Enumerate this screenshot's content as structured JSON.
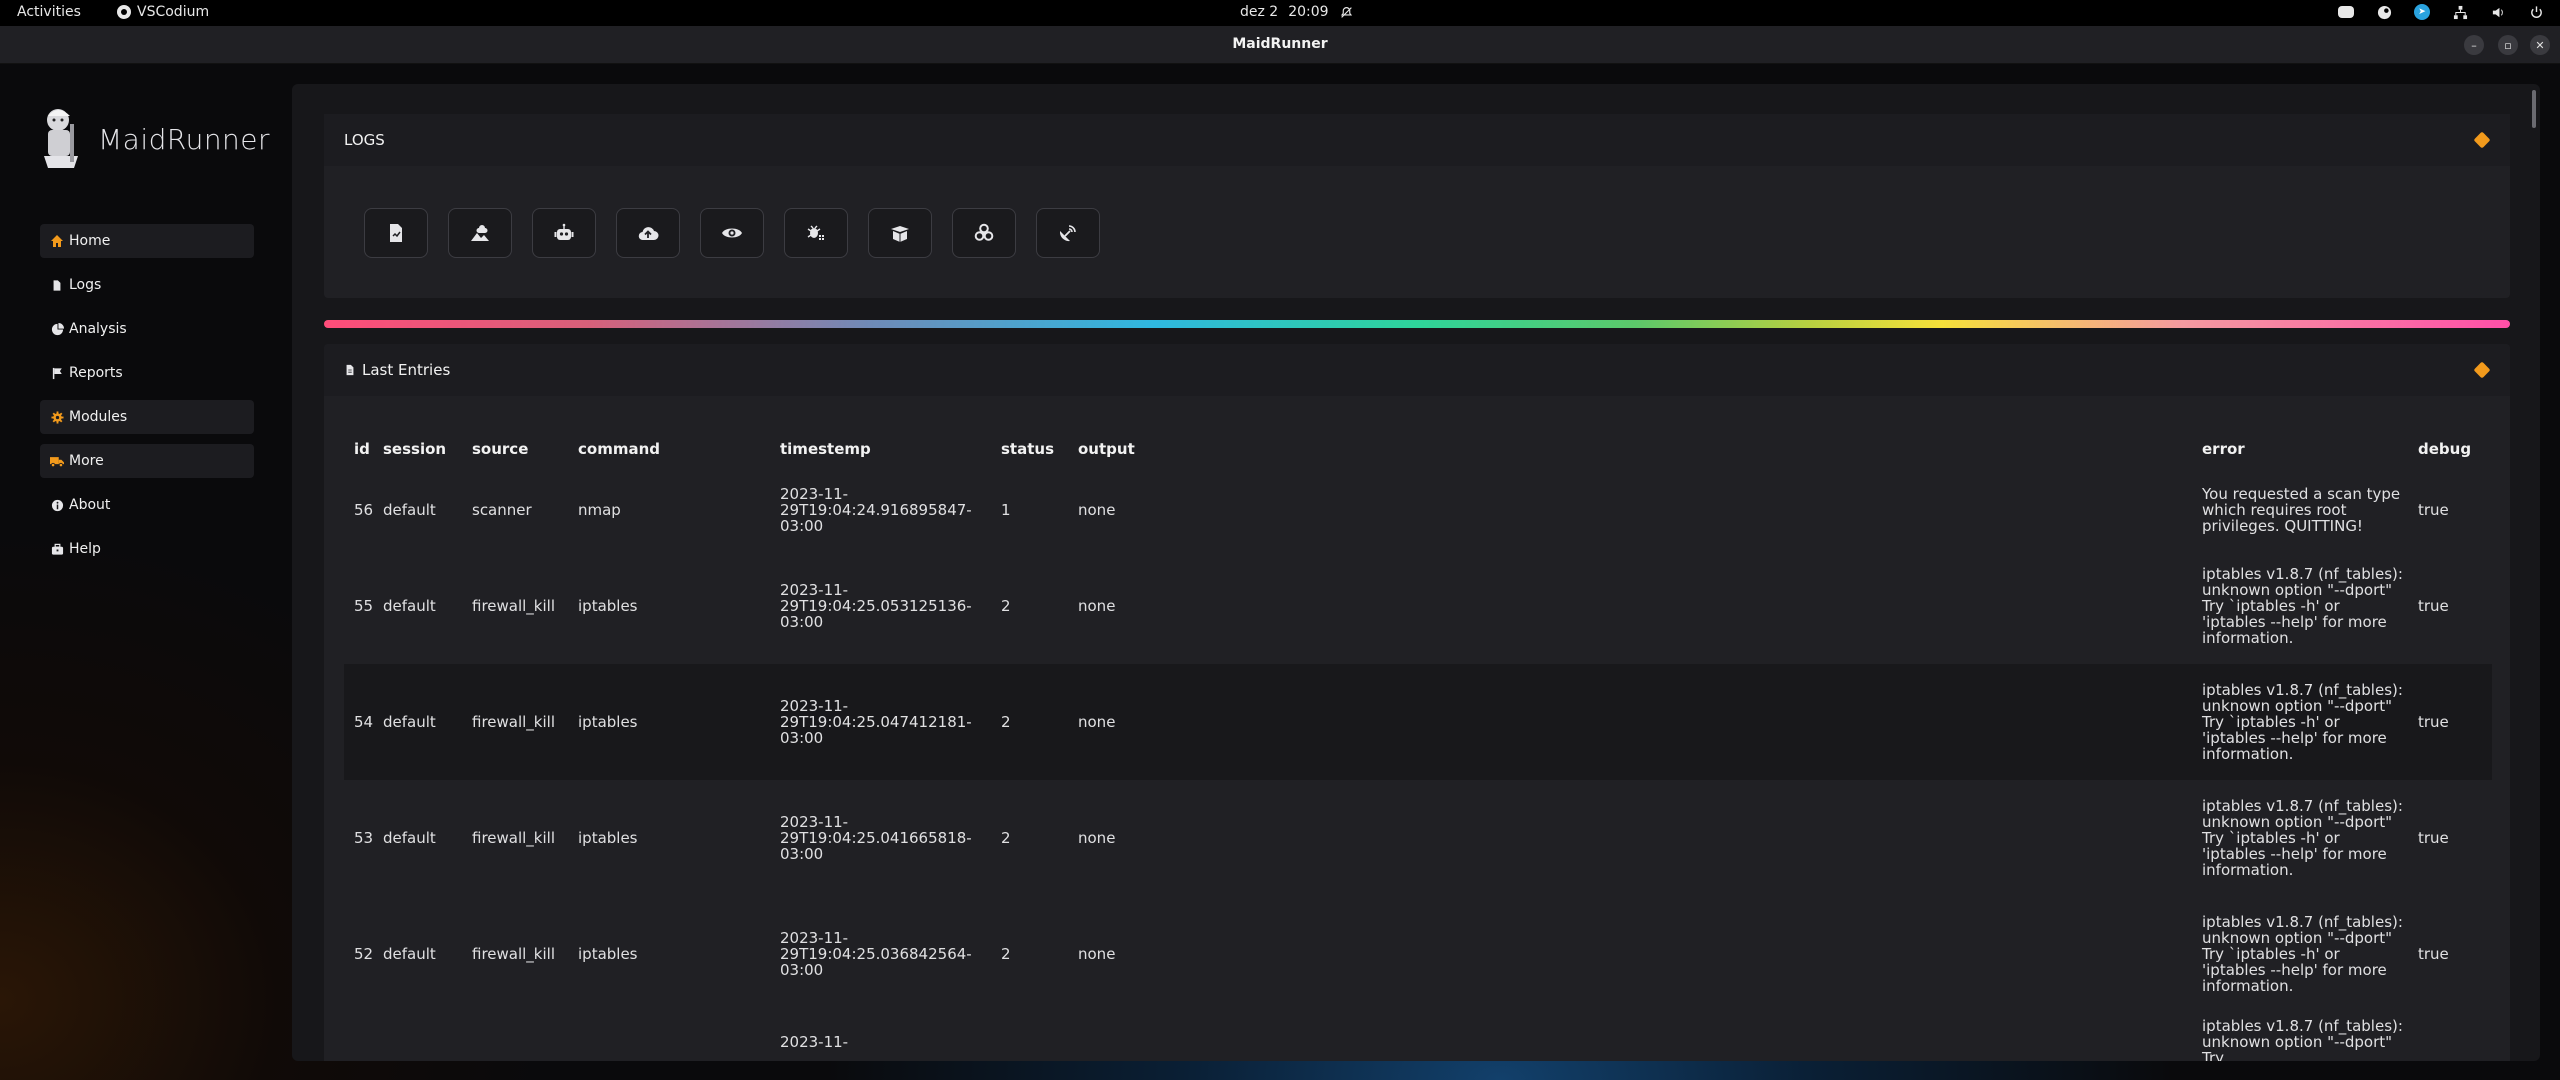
{
  "topbar": {
    "activities": "Activities",
    "app_name": "VSCodium",
    "date": "dez 2",
    "time": "20:09"
  },
  "window": {
    "title": "MaidRunner"
  },
  "brand": {
    "name": "MaidRunner"
  },
  "nav": {
    "items": [
      {
        "label": "Home",
        "icon": "home-icon",
        "highlight": true
      },
      {
        "label": "Logs",
        "icon": "file-icon",
        "highlight": false
      },
      {
        "label": "Analysis",
        "icon": "pie-chart-icon",
        "highlight": false
      },
      {
        "label": "Reports",
        "icon": "flag-icon",
        "highlight": false
      },
      {
        "label": "Modules",
        "icon": "gear-icon",
        "highlight": true
      },
      {
        "label": "More",
        "icon": "truck-icon",
        "highlight": true
      },
      {
        "label": "About",
        "icon": "info-icon",
        "highlight": false
      },
      {
        "label": "Help",
        "icon": "briefcase-icon",
        "highlight": false
      }
    ]
  },
  "logs_card": {
    "title": "LOGS",
    "modules": [
      "file-chart-icon",
      "cloud-mountain-icon",
      "robot-icon",
      "cloud-upload-icon",
      "eye-icon",
      "bug-grid-icon",
      "open-box-icon",
      "biohazard-icon",
      "satellite-dish-icon"
    ]
  },
  "entries_card": {
    "title": "Last Entries",
    "columns": [
      "id",
      "session",
      "source",
      "command",
      "timestemp",
      "status",
      "output",
      "error",
      "debug"
    ],
    "rows": [
      {
        "id": "56",
        "session": "default",
        "source": "scanner",
        "command": "nmap",
        "timestamp": "2023-11-29T19:04:24.916895847-03:00",
        "status": "1",
        "output": "none",
        "error": "You requested a scan type which requires root privileges. QUITTING!",
        "debug": "true"
      },
      {
        "id": "55",
        "session": "default",
        "source": "firewall_kill",
        "command": "iptables",
        "timestamp": "2023-11-29T19:04:25.053125136-03:00",
        "status": "2",
        "output": "none",
        "error": "iptables v1.8.7 (nf_tables): unknown option \"--dport\" Try `iptables -h' or 'iptables --help' for more information.",
        "debug": "true"
      },
      {
        "id": "54",
        "session": "default",
        "source": "firewall_kill",
        "command": "iptables",
        "timestamp": "2023-11-29T19:04:25.047412181-03:00",
        "status": "2",
        "output": "none",
        "error": "iptables v1.8.7 (nf_tables): unknown option \"--dport\" Try `iptables -h' or 'iptables --help' for more information.",
        "debug": "true"
      },
      {
        "id": "53",
        "session": "default",
        "source": "firewall_kill",
        "command": "iptables",
        "timestamp": "2023-11-29T19:04:25.041665818-03:00",
        "status": "2",
        "output": "none",
        "error": "iptables v1.8.7 (nf_tables): unknown option \"--dport\" Try `iptables -h' or 'iptables --help' for more information.",
        "debug": "true"
      },
      {
        "id": "52",
        "session": "default",
        "source": "firewall_kill",
        "command": "iptables",
        "timestamp": "2023-11-29T19:04:25.036842564-03:00",
        "status": "2",
        "output": "none",
        "error": "iptables v1.8.7 (nf_tables): unknown option \"--dport\" Try `iptables -h' or 'iptables --help' for more information.",
        "debug": "true"
      },
      {
        "id": "",
        "session": "",
        "source": "",
        "command": "",
        "timestamp": "2023-11-",
        "status": "",
        "output": "",
        "error": "iptables v1.8.7 (nf_tables): unknown option \"--dport\" Try",
        "debug": ""
      }
    ]
  },
  "colors": {
    "accent_orange": "#f29a1c",
    "panel": "#202024",
    "background": "#17171a"
  }
}
